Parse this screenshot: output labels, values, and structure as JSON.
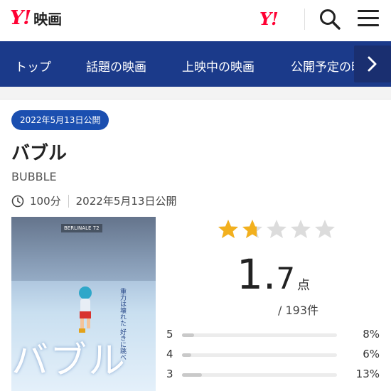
{
  "header": {
    "logo_mark": "Y!",
    "logo_text": "映画",
    "partner_logo": "Y!",
    "search_icon": "search-icon",
    "menu_icon": "hamburger-menu-icon"
  },
  "nav": {
    "items": [
      {
        "label": "トップ"
      },
      {
        "label": "話題の映画"
      },
      {
        "label": "上映中の映画"
      },
      {
        "label": "公開予定の映画"
      }
    ],
    "more_icon": "chevron-right-icon"
  },
  "movie": {
    "release_badge": "2022年5月13日公開",
    "title": "バブル",
    "english_title": "BUBBLE",
    "runtime": "100分",
    "release_text": "2022年5月13日公開",
    "poster": {
      "title": "バブル",
      "tagline": "重力は壊れた 好きに跳べ"
    }
  },
  "rating": {
    "score_int": "1.",
    "score_dec": "7",
    "unit": "点",
    "count": "/ 193件",
    "stars_value": 1.7,
    "stars_max": 5,
    "colors": {
      "star_on": "#f2b01e",
      "star_off": "#dcdcdc"
    },
    "distribution": [
      {
        "star": "5",
        "percent": "8%",
        "value": 0.08
      },
      {
        "star": "4",
        "percent": "6%",
        "value": 0.06
      },
      {
        "star": "3",
        "percent": "13%",
        "value": 0.13
      }
    ]
  }
}
